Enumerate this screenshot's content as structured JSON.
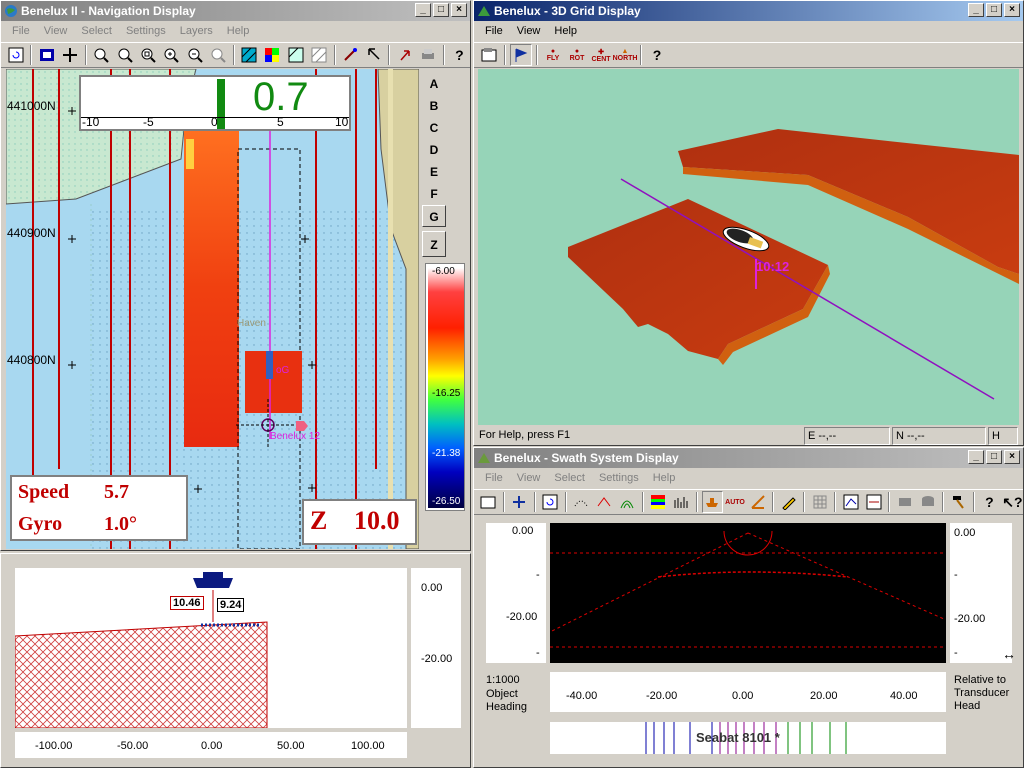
{
  "nav": {
    "title": "Benelux II - Navigation Display",
    "menu": [
      "File",
      "View",
      "Select",
      "Settings",
      "Layers",
      "Help"
    ],
    "north_labels": [
      "441000N",
      "440900N",
      "440800N"
    ],
    "gauge": {
      "value": "0.7",
      "ticks": [
        "-10",
        "-5",
        "0",
        "5",
        "10"
      ],
      "level": 0.7
    },
    "letters": [
      "A",
      "B",
      "C",
      "D",
      "E",
      "F",
      "G",
      "Z"
    ],
    "colorbar": [
      "-6.00",
      "-16.25",
      "-21.38",
      "-26.50"
    ],
    "speed_label": "Speed",
    "speed_value": "5.7",
    "gyro_label": "Gyro",
    "gyro_value": "1.0°",
    "z_label": "Z",
    "z_value": "10.0",
    "vessel_label": "Benelux 12",
    "haven_label": "Haven",
    "logo_label": "oG",
    "profile": {
      "left_value": "10.46",
      "right_value": "9.24",
      "y_labels": [
        "0.00",
        "-20.00"
      ],
      "x_labels": [
        "-100.00",
        "-50.00",
        "0.00",
        "50.00",
        "100.00"
      ]
    }
  },
  "grid3d": {
    "title": "Benelux - 3D Grid Display",
    "menu": [
      "File",
      "View",
      "Help"
    ],
    "buttons": [
      "FLY",
      "ROT",
      "CENT",
      "NORTH"
    ],
    "time_label": "10:12",
    "status": [
      "For Help, press F1",
      "E --,--",
      "N --,--",
      "H"
    ]
  },
  "swath": {
    "title": "Benelux - Swath System Display",
    "menu": [
      "File",
      "View",
      "Select",
      "Settings",
      "Help"
    ],
    "y_left": [
      "0.00",
      "-",
      "-20.00",
      "-"
    ],
    "y_right": [
      "0.00",
      "-",
      "-20.00",
      "-"
    ],
    "x_labels": [
      "-40.00",
      "-20.00",
      "0.00",
      "20.00",
      "40.00"
    ],
    "scale": "1:1000",
    "object_heading": "Object Heading",
    "relative": "Relative to Transducer Head",
    "sonar": "Seabat 8101 *",
    "auto_btn": "AUTO"
  },
  "colors": {
    "accent": "#0a246a",
    "readout": "#c00000",
    "gauge": "#118a11",
    "track": "#dd22dd",
    "water": "#a8d8f0",
    "land": "#d8d0a0"
  }
}
